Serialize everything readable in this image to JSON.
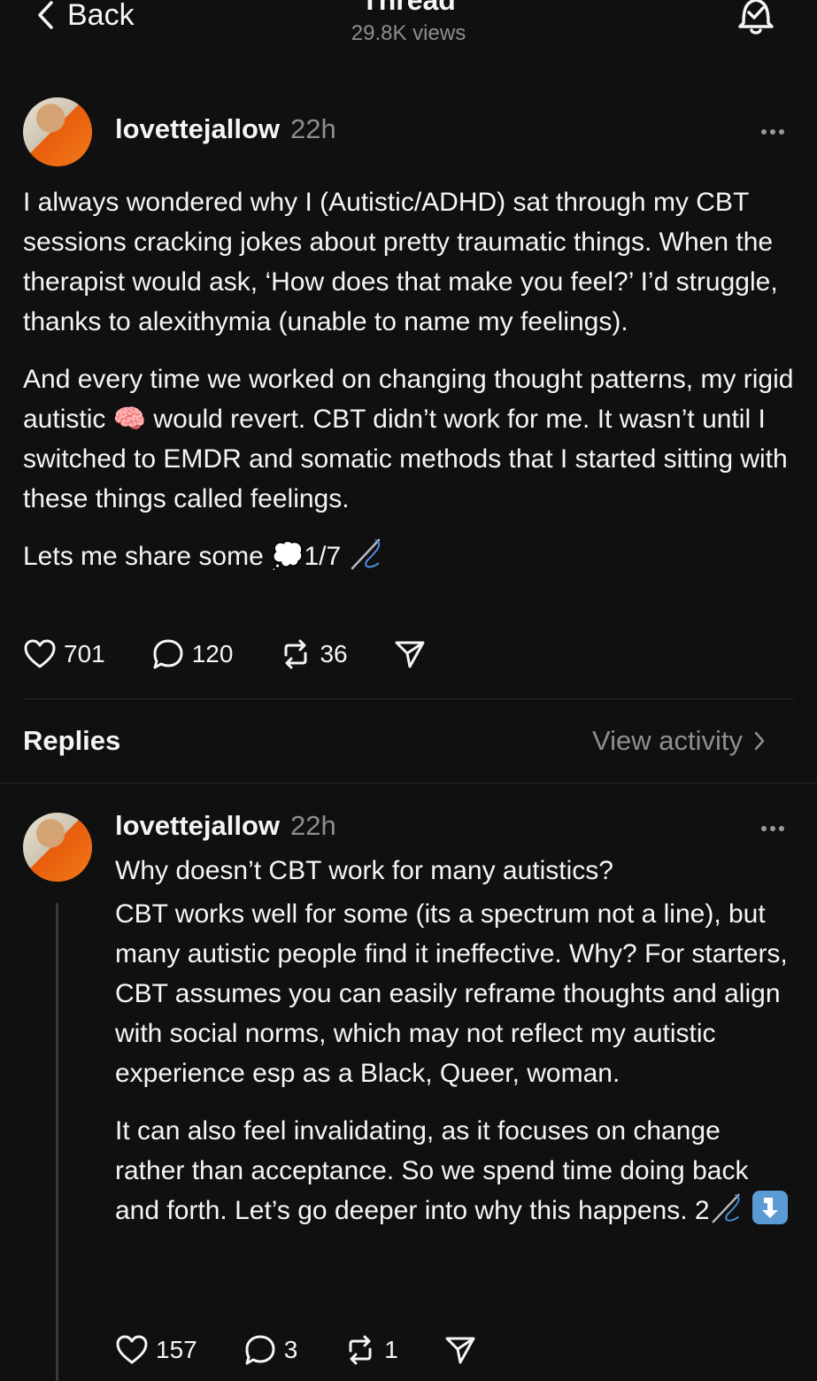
{
  "nav": {
    "back_label": "Back",
    "title": "Thread",
    "views": "29.8K views"
  },
  "main_post": {
    "username": "lovettejallow",
    "time": "22h",
    "paragraph1": "I always wondered why I (Autistic/ADHD) sat through my CBT sessions cracking jokes about pretty traumatic things. When the therapist would ask, ‘How does that make you feel?’ I’d struggle, thanks to alexithymia (unable to name my feelings).",
    "paragraph2_before": "And every time we worked on changing thought patterns, my rigid autistic",
    "paragraph2_emoji": "🧠",
    "paragraph2_after": "would revert. CBT didn’t work for me. It wasn’t until I switched to EMDR and somatic methods that I started sitting with these things called feelings.",
    "paragraph3_before": "Lets me share some",
    "paragraph3_emoji": "💭",
    "paragraph3_after": "1/7",
    "likes": "701",
    "comments": "120",
    "reposts": "36"
  },
  "replies_header": {
    "label": "Replies",
    "activity_link": "View activity"
  },
  "reply": {
    "username": "lovettejallow",
    "time": "22h",
    "heading": "Why doesn’t CBT work for many autistics?",
    "paragraph1": "CBT works well for some (its a spectrum not a line), but many autistic people find it ineffective. Why? For starters, CBT assumes you can easily reframe thoughts and align with social norms, which may not reflect my autistic experience esp as a Black, Queer, woman.",
    "paragraph2": "It can also feel invalidating, as it focuses on change rather than acceptance. So we spend time doing back and forth. Let’s go deeper into why this happens. 2",
    "likes": "157",
    "comments": "3",
    "reposts": "1"
  },
  "icons": {
    "back": "chevron-left-icon",
    "bell": "notification-bell-icon",
    "more": "more-icon",
    "like": "heart-icon",
    "comment": "comment-icon",
    "repost": "repost-icon",
    "share": "share-icon",
    "needle": "needle-thread-icon",
    "down_arrow": "down-arrow-emoji-icon"
  }
}
